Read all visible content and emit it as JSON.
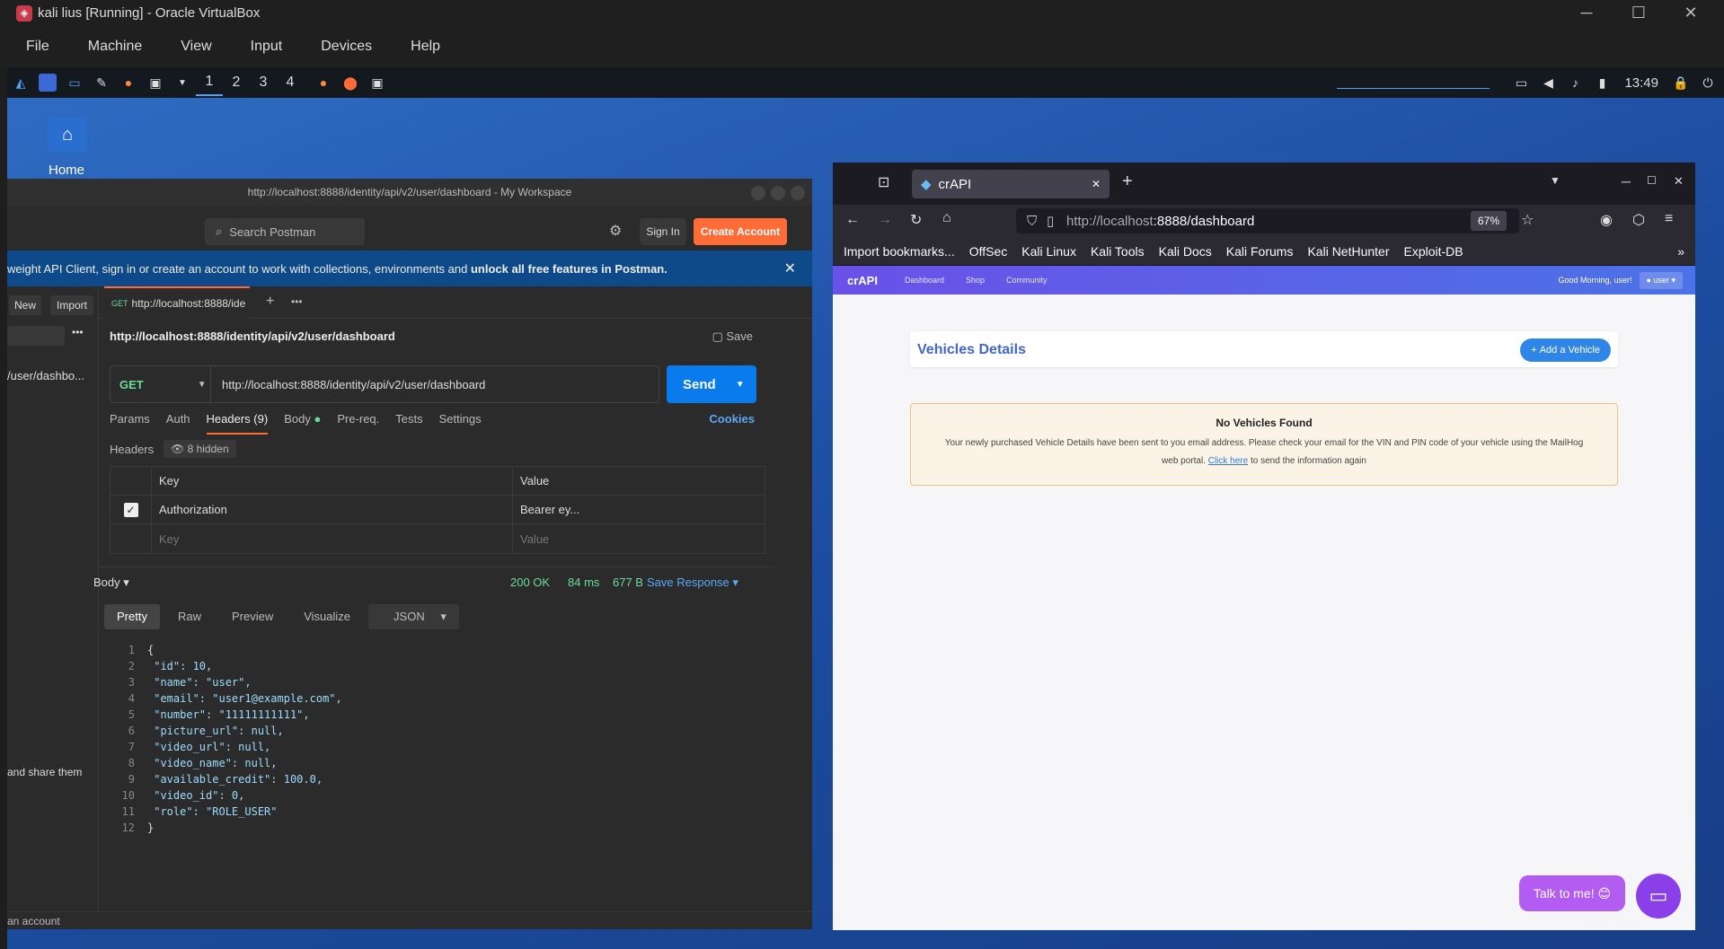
{
  "vbox": {
    "title": "kali lius [Running] - Oracle VirtualBox",
    "menu": [
      "File",
      "Machine",
      "View",
      "Input",
      "Devices",
      "Help"
    ]
  },
  "kali": {
    "workspaces": [
      "1",
      "2",
      "3",
      "4"
    ],
    "clock": "13:49"
  },
  "desktop": {
    "home_label": "Home"
  },
  "postman": {
    "window_title": "http://localhost:8888/identity/api/v2/user/dashboard - My Workspace",
    "search_placeholder": "Search Postman",
    "sign_in": "Sign In",
    "create_account": "Create Account",
    "banner_text": "weight API Client, sign in or create an account to work with collections, environments and",
    "banner_bold": "unlock all free features in Postman.",
    "new_label": "New",
    "import_label": "Import",
    "sidebar_item": "/user/dashbo...",
    "sidebar_footer": "and share them",
    "tab_method": "GET",
    "tab_label": "http://localhost:8888/ide",
    "request_name": "http://localhost:8888/identity/api/v2/user/dashboard",
    "save_label": "Save",
    "method": "GET",
    "url": "http://localhost:8888/identity/api/v2/user/dashboard",
    "send_label": "Send",
    "subtabs": {
      "params": "Params",
      "auth": "Auth",
      "headers": "Headers (9)",
      "body": "Body",
      "prereq": "Pre-req.",
      "tests": "Tests",
      "settings": "Settings"
    },
    "cookies": "Cookies",
    "headers_label": "Headers",
    "hidden_label": "8 hidden",
    "col_key": "Key",
    "col_value": "Value",
    "row_key": "Authorization",
    "row_value": "Bearer ey...",
    "placeholder_key": "Key",
    "placeholder_value": "Value",
    "response": {
      "body_label": "Body",
      "status": "200 OK",
      "time": "84 ms",
      "size": "677 B",
      "save_response": "Save Response"
    },
    "view_tabs": {
      "pretty": "Pretty",
      "raw": "Raw",
      "preview": "Preview",
      "visualize": "Visualize",
      "format": "JSON"
    },
    "json_lines": [
      "{",
      "    \"id\": 10,",
      "    \"name\": \"user\",",
      "    \"email\": \"user1@example.com\",",
      "    \"number\": \"11111111111\",",
      "    \"picture_url\": null,",
      "    \"video_url\": null,",
      "    \"video_name\": null,",
      "    \"available_credit\": 100.0,",
      "    \"video_id\": 0,",
      "    \"role\": \"ROLE_USER\"",
      "}"
    ],
    "status_text": "an account"
  },
  "firefox": {
    "tab_title": "crAPI",
    "url_prefix": "http://localhost",
    "url_rest": ":8888/dashboard",
    "zoom": "67%",
    "bookmarks": [
      "Import bookmarks...",
      "OffSec",
      "Kali Linux",
      "Kali Tools",
      "Kali Docs",
      "Kali Forums",
      "Kali NetHunter",
      "Exploit-DB"
    ]
  },
  "crapi": {
    "logo": "crAPI",
    "nav": [
      "Dashboard",
      "Shop",
      "Community"
    ],
    "greeting": "Good Morning, user!",
    "user_menu": "user",
    "vehicles_title": "Vehicles Details",
    "add_vehicle": "Add a Vehicle",
    "nvf_title": "No Vehicles Found",
    "nvf_text": "Your newly purchased Vehicle Details have been sent to you email address. Please check your email for the VIN and PIN code of your vehicle using the MailHog web portal.",
    "nvf_link": "Click here",
    "nvf_after": "to send the information again",
    "talk": "Talk to me! 😊"
  }
}
